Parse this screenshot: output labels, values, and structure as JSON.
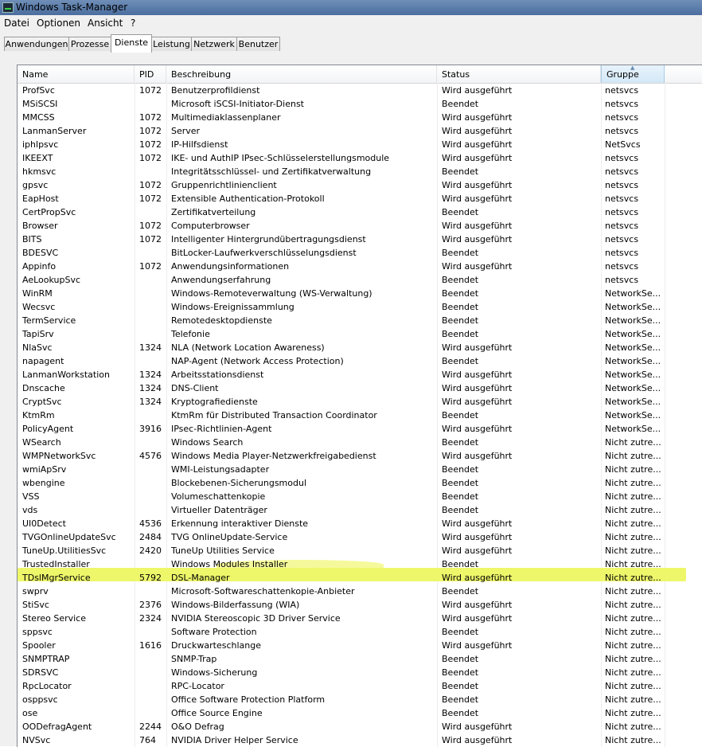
{
  "window": {
    "title": "Windows Task-Manager"
  },
  "menu": [
    "Datei",
    "Optionen",
    "Ansicht",
    "?"
  ],
  "tabs": [
    "Anwendungen",
    "Prozesse",
    "Dienste",
    "Leistung",
    "Netzwerk",
    "Benutzer"
  ],
  "active_tab": "Dienste",
  "columns": {
    "name": "Name",
    "pid": "PID",
    "desc": "Beschreibung",
    "status": "Status",
    "group": "Gruppe"
  },
  "highlight_color": "#eef76a",
  "services": [
    {
      "name": "ProfSvc",
      "pid": "1072",
      "desc": "Benutzerprofildienst",
      "status": "Wird ausgeführt",
      "group": "netsvcs"
    },
    {
      "name": "MSiSCSI",
      "pid": "",
      "desc": "Microsoft iSCSI-Initiator-Dienst",
      "status": "Beendet",
      "group": "netsvcs"
    },
    {
      "name": "MMCSS",
      "pid": "1072",
      "desc": "Multimediaklassenplaner",
      "status": "Wird ausgeführt",
      "group": "netsvcs"
    },
    {
      "name": "LanmanServer",
      "pid": "1072",
      "desc": "Server",
      "status": "Wird ausgeführt",
      "group": "netsvcs"
    },
    {
      "name": "iphlpsvc",
      "pid": "1072",
      "desc": "IP-Hilfsdienst",
      "status": "Wird ausgeführt",
      "group": "NetSvcs"
    },
    {
      "name": "IKEEXT",
      "pid": "1072",
      "desc": "IKE- und AuthIP IPsec-Schlüsselerstellungsmodule",
      "status": "Wird ausgeführt",
      "group": "netsvcs"
    },
    {
      "name": "hkmsvc",
      "pid": "",
      "desc": "Integritätsschlüssel- und Zertifikatverwaltung",
      "status": "Beendet",
      "group": "netsvcs"
    },
    {
      "name": "gpsvc",
      "pid": "1072",
      "desc": "Gruppenrichtlinienclient",
      "status": "Wird ausgeführt",
      "group": "netsvcs"
    },
    {
      "name": "EapHost",
      "pid": "1072",
      "desc": "Extensible Authentication-Protokoll",
      "status": "Wird ausgeführt",
      "group": "netsvcs"
    },
    {
      "name": "CertPropSvc",
      "pid": "",
      "desc": "Zertifikatverteilung",
      "status": "Beendet",
      "group": "netsvcs"
    },
    {
      "name": "Browser",
      "pid": "1072",
      "desc": "Computerbrowser",
      "status": "Wird ausgeführt",
      "group": "netsvcs"
    },
    {
      "name": "BITS",
      "pid": "1072",
      "desc": "Intelligenter Hintergrundübertragungsdienst",
      "status": "Wird ausgeführt",
      "group": "netsvcs"
    },
    {
      "name": "BDESVC",
      "pid": "",
      "desc": "BitLocker-Laufwerkverschlüsselungsdienst",
      "status": "Beendet",
      "group": "netsvcs"
    },
    {
      "name": "Appinfo",
      "pid": "1072",
      "desc": "Anwendungsinformationen",
      "status": "Wird ausgeführt",
      "group": "netsvcs"
    },
    {
      "name": "AeLookupSvc",
      "pid": "",
      "desc": "Anwendungserfahrung",
      "status": "Beendet",
      "group": "netsvcs"
    },
    {
      "name": "WinRM",
      "pid": "",
      "desc": "Windows-Remoteverwaltung (WS-Verwaltung)",
      "status": "Beendet",
      "group": "NetworkSe..."
    },
    {
      "name": "Wecsvc",
      "pid": "",
      "desc": "Windows-Ereignissammlung",
      "status": "Beendet",
      "group": "NetworkSe..."
    },
    {
      "name": "TermService",
      "pid": "",
      "desc": "Remotedesktopdienste",
      "status": "Beendet",
      "group": "NetworkSe..."
    },
    {
      "name": "TapiSrv",
      "pid": "",
      "desc": "Telefonie",
      "status": "Beendet",
      "group": "NetworkSe..."
    },
    {
      "name": "NlaSvc",
      "pid": "1324",
      "desc": "NLA (Network Location Awareness)",
      "status": "Wird ausgeführt",
      "group": "NetworkSe..."
    },
    {
      "name": "napagent",
      "pid": "",
      "desc": "NAP-Agent (Network Access Protection)",
      "status": "Beendet",
      "group": "NetworkSe..."
    },
    {
      "name": "LanmanWorkstation",
      "pid": "1324",
      "desc": "Arbeitsstationsdienst",
      "status": "Wird ausgeführt",
      "group": "NetworkSe..."
    },
    {
      "name": "Dnscache",
      "pid": "1324",
      "desc": "DNS-Client",
      "status": "Wird ausgeführt",
      "group": "NetworkSe..."
    },
    {
      "name": "CryptSvc",
      "pid": "1324",
      "desc": "Kryptografiedienste",
      "status": "Wird ausgeführt",
      "group": "NetworkSe..."
    },
    {
      "name": "KtmRm",
      "pid": "",
      "desc": "KtmRm für Distributed Transaction Coordinator",
      "status": "Beendet",
      "group": "NetworkSe..."
    },
    {
      "name": "PolicyAgent",
      "pid": "3916",
      "desc": "IPsec-Richtlinien-Agent",
      "status": "Wird ausgeführt",
      "group": "NetworkSe..."
    },
    {
      "name": "WSearch",
      "pid": "",
      "desc": "Windows Search",
      "status": "Beendet",
      "group": "Nicht zutre..."
    },
    {
      "name": "WMPNetworkSvc",
      "pid": "4576",
      "desc": "Windows Media Player-Netzwerkfreigabedienst",
      "status": "Wird ausgeführt",
      "group": "Nicht zutre..."
    },
    {
      "name": "wmiApSrv",
      "pid": "",
      "desc": "WMI-Leistungsadapter",
      "status": "Beendet",
      "group": "Nicht zutre..."
    },
    {
      "name": "wbengine",
      "pid": "",
      "desc": "Blockebenen-Sicherungsmodul",
      "status": "Beendet",
      "group": "Nicht zutre..."
    },
    {
      "name": "VSS",
      "pid": "",
      "desc": "Volumeschattenkopie",
      "status": "Beendet",
      "group": "Nicht zutre..."
    },
    {
      "name": "vds",
      "pid": "",
      "desc": "Virtueller Datenträger",
      "status": "Beendet",
      "group": "Nicht zutre..."
    },
    {
      "name": "UI0Detect",
      "pid": "4536",
      "desc": "Erkennung interaktiver Dienste",
      "status": "Wird ausgeführt",
      "group": "Nicht zutre..."
    },
    {
      "name": "TVGOnlineUpdateSvc",
      "pid": "2484",
      "desc": "TVG OnlineUpdate-Service",
      "status": "Wird ausgeführt",
      "group": "Nicht zutre..."
    },
    {
      "name": "TuneUp.UtilitiesSvc",
      "pid": "2420",
      "desc": "TuneUp Utilities Service",
      "status": "Wird ausgeführt",
      "group": "Nicht zutre..."
    },
    {
      "name": "TrustedInstaller",
      "pid": "",
      "desc": "Windows Modules Installer",
      "status": "Beendet",
      "group": "Nicht zutre..."
    },
    {
      "name": "TDslMgrService",
      "pid": "5792",
      "desc": "DSL-Manager",
      "status": "Wird ausgeführt",
      "group": "Nicht zutre...",
      "highlighted": true
    },
    {
      "name": "swprv",
      "pid": "",
      "desc": "Microsoft-Softwareschattenkopie-Anbieter",
      "status": "Beendet",
      "group": "Nicht zutre..."
    },
    {
      "name": "StiSvc",
      "pid": "2376",
      "desc": "Windows-Bilderfassung (WIA)",
      "status": "Wird ausgeführt",
      "group": "Nicht zutre..."
    },
    {
      "name": "Stereo Service",
      "pid": "2324",
      "desc": "NVIDIA Stereoscopic 3D Driver Service",
      "status": "Wird ausgeführt",
      "group": "Nicht zutre..."
    },
    {
      "name": "sppsvc",
      "pid": "",
      "desc": "Software Protection",
      "status": "Beendet",
      "group": "Nicht zutre..."
    },
    {
      "name": "Spooler",
      "pid": "1616",
      "desc": "Druckwarteschlange",
      "status": "Wird ausgeführt",
      "group": "Nicht zutre..."
    },
    {
      "name": "SNMPTRAP",
      "pid": "",
      "desc": "SNMP-Trap",
      "status": "Beendet",
      "group": "Nicht zutre..."
    },
    {
      "name": "SDRSVC",
      "pid": "",
      "desc": "Windows-Sicherung",
      "status": "Beendet",
      "group": "Nicht zutre..."
    },
    {
      "name": "RpcLocator",
      "pid": "",
      "desc": "RPC-Locator",
      "status": "Beendet",
      "group": "Nicht zutre..."
    },
    {
      "name": "osppsvc",
      "pid": "",
      "desc": "Office Software Protection Platform",
      "status": "Beendet",
      "group": "Nicht zutre..."
    },
    {
      "name": "ose",
      "pid": "",
      "desc": "Office  Source Engine",
      "status": "Beendet",
      "group": "Nicht zutre..."
    },
    {
      "name": "OODefragAgent",
      "pid": "2244",
      "desc": "O&O Defrag",
      "status": "Wird ausgeführt",
      "group": "Nicht zutre..."
    },
    {
      "name": "NVSvc",
      "pid": "764",
      "desc": "NVIDIA Driver Helper Service",
      "status": "Wird ausgeführt",
      "group": "Nicht zutre..."
    }
  ]
}
